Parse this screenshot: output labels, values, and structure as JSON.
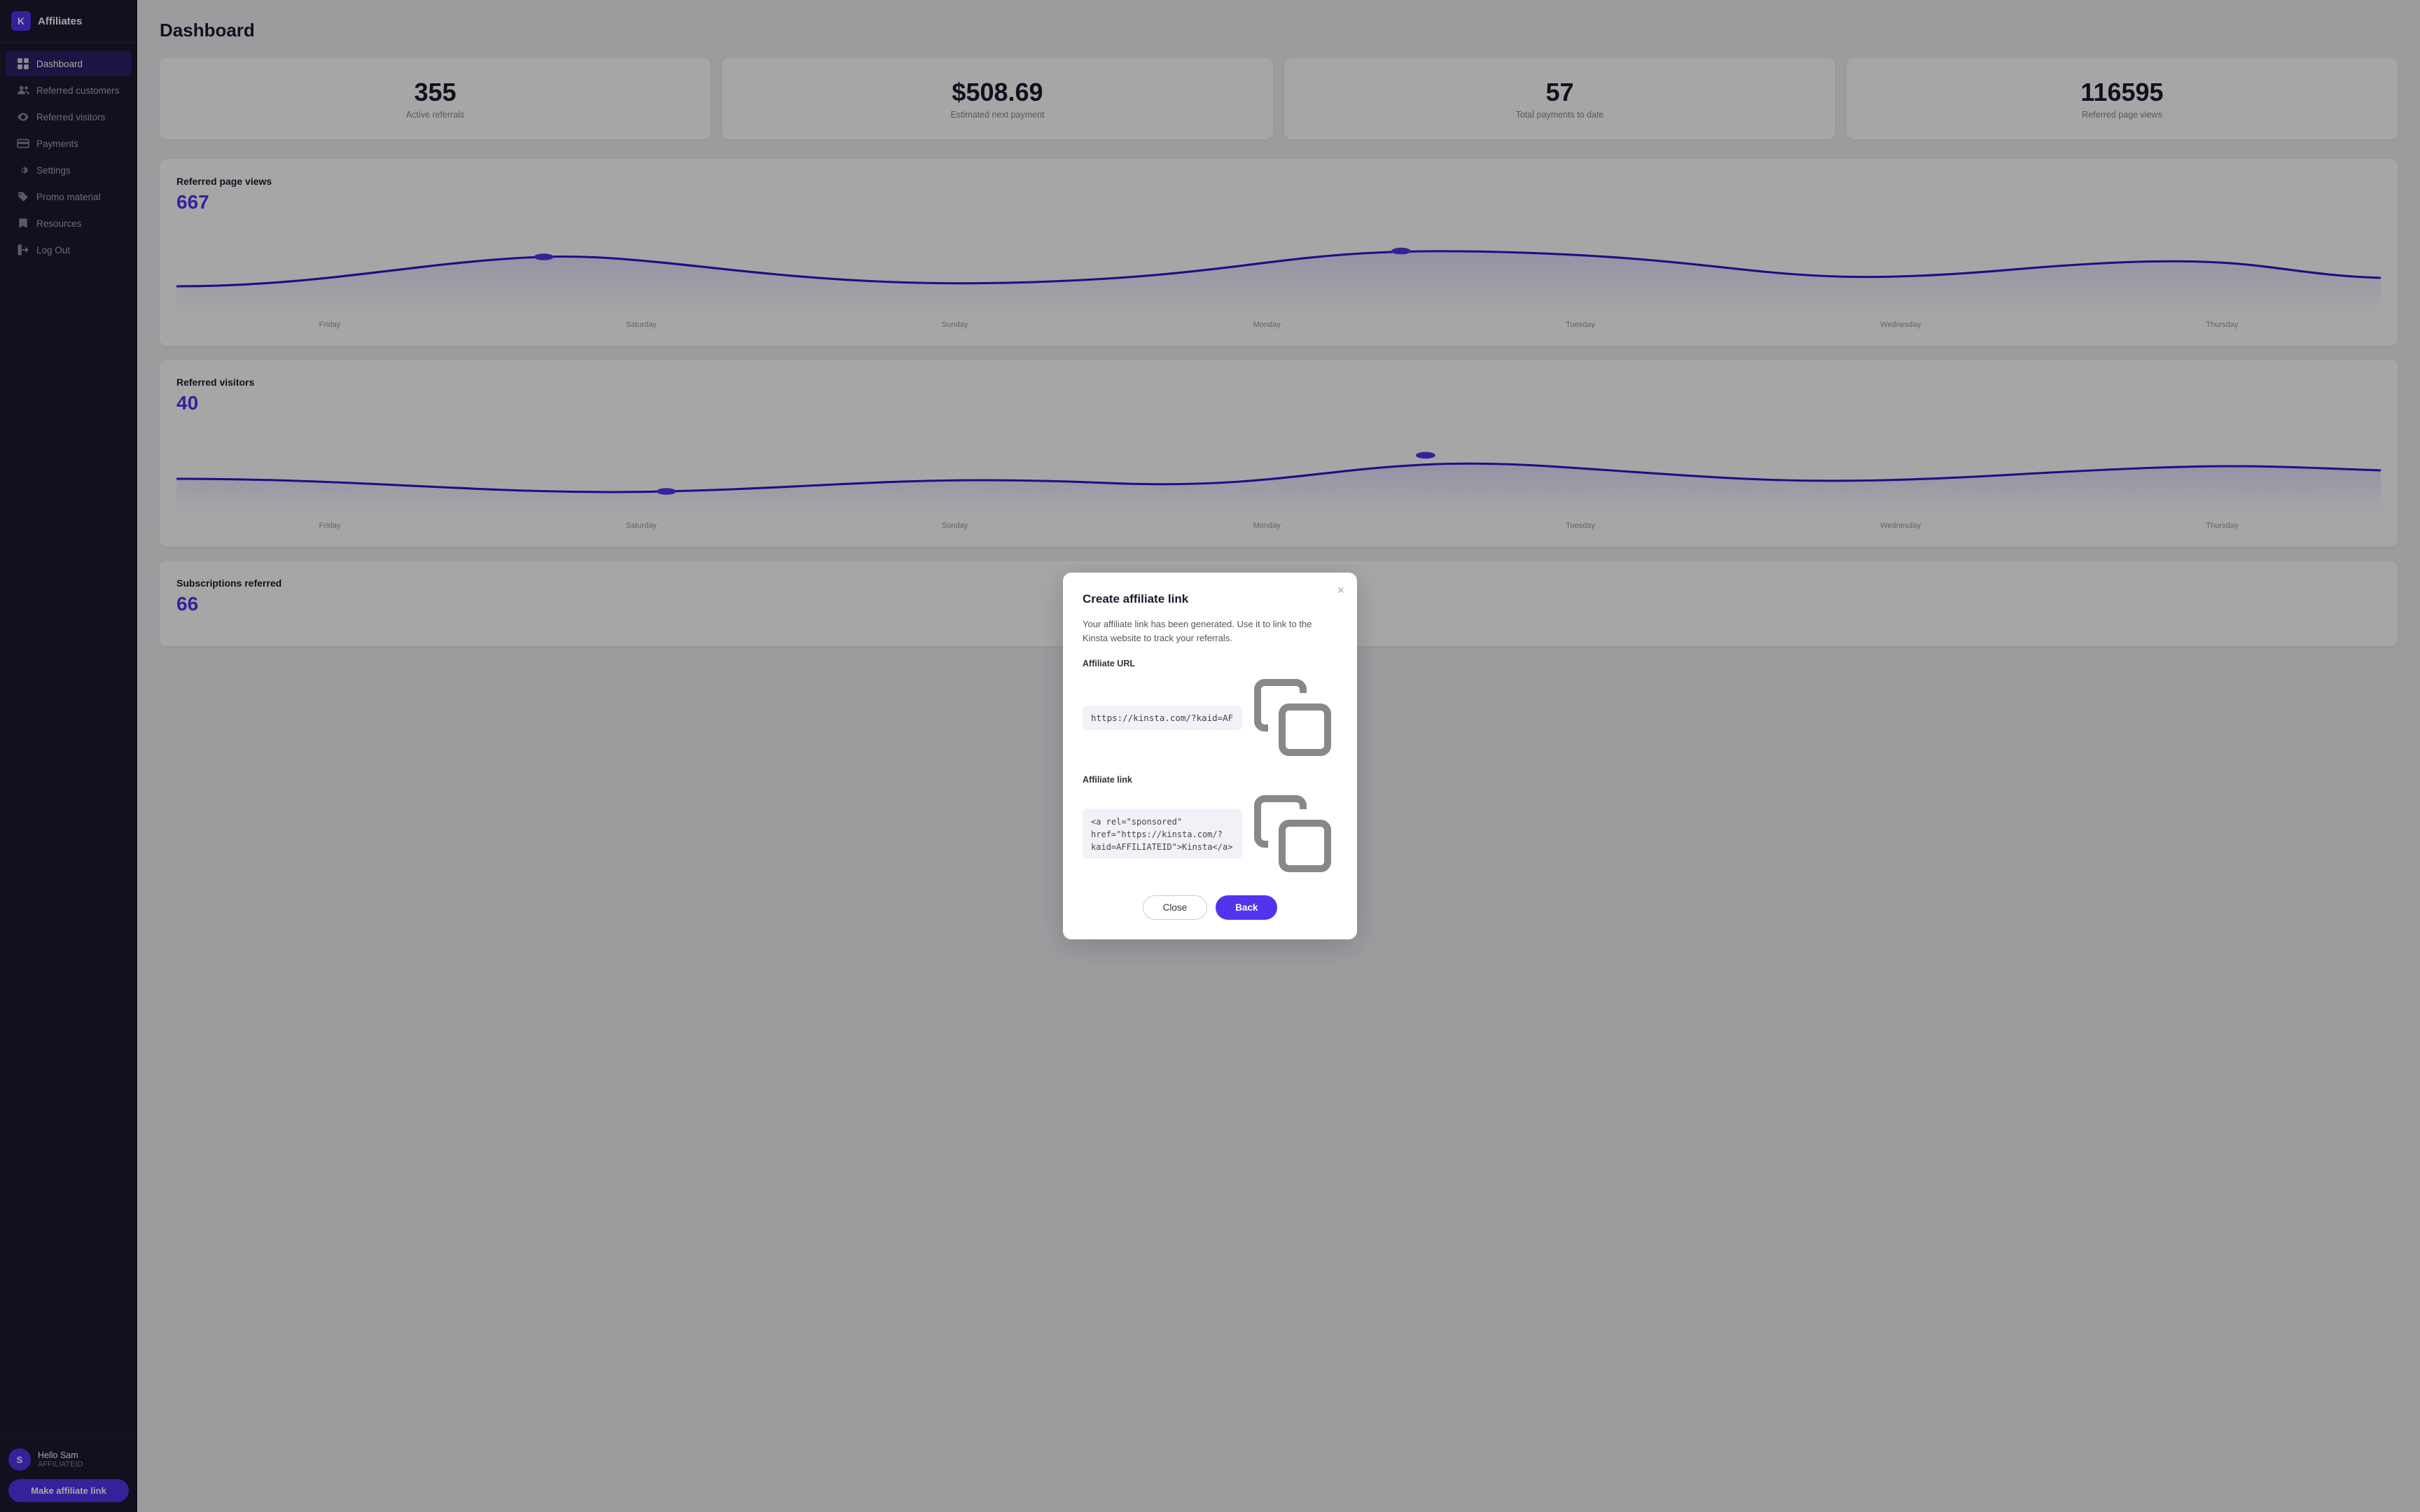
{
  "app": {
    "logo_letter": "K",
    "title": "Affiliates"
  },
  "sidebar": {
    "items": [
      {
        "id": "dashboard",
        "label": "Dashboard",
        "icon": "grid",
        "active": true
      },
      {
        "id": "referred-customers",
        "label": "Referred customers",
        "icon": "users"
      },
      {
        "id": "referred-visitors",
        "label": "Referred visitors",
        "icon": "eye"
      },
      {
        "id": "payments",
        "label": "Payments",
        "icon": "credit-card"
      },
      {
        "id": "settings",
        "label": "Settings",
        "icon": "settings"
      },
      {
        "id": "promo-material",
        "label": "Promo material",
        "icon": "tag"
      },
      {
        "id": "resources",
        "label": "Resources",
        "icon": "bookmark"
      },
      {
        "id": "log-out",
        "label": "Log Out",
        "icon": "logout"
      }
    ],
    "user": {
      "name": "Hello Sam",
      "id": "AFFILIATEID",
      "initials": "S"
    },
    "make_link_label": "Make affiliate link"
  },
  "page": {
    "title": "Dashboard"
  },
  "stats": [
    {
      "number": "355",
      "label": "Active referrals"
    },
    {
      "number": "$508.69",
      "label": "Estimated next payment"
    },
    {
      "number": "57",
      "label": "Total payments to date"
    },
    {
      "number": "116595",
      "label": "Referred page views"
    }
  ],
  "charts": [
    {
      "title": "Referred page views",
      "value": "667",
      "labels": [
        "Friday",
        "Saturday",
        "Sunday",
        "Monday",
        "Tuesday",
        "Wednesday",
        "Thursday"
      ]
    },
    {
      "title": "Referred visitors",
      "value": "40",
      "labels": [
        "Friday",
        "Saturday",
        "Sunday",
        "Monday",
        "Tuesday",
        "Wednesday",
        "Thursday"
      ]
    },
    {
      "title": "Subscriptions referred",
      "value": "66",
      "labels": []
    }
  ],
  "modal": {
    "title": "Create affiliate link",
    "description": "Your affiliate link has been generated. Use it to link to the Kinsta website to track your referrals.",
    "affiliate_url_label": "Affiliate URL",
    "affiliate_url_value": "https://kinsta.com/?kaid=AFFILIATEID",
    "affiliate_link_label": "Affiliate link",
    "affiliate_link_value": "<a rel=\"sponsored\" href=\"https://kinsta.com/?kaid=AFFILIATEID\">Kinsta</a>",
    "close_label": "Close",
    "back_label": "Back"
  }
}
